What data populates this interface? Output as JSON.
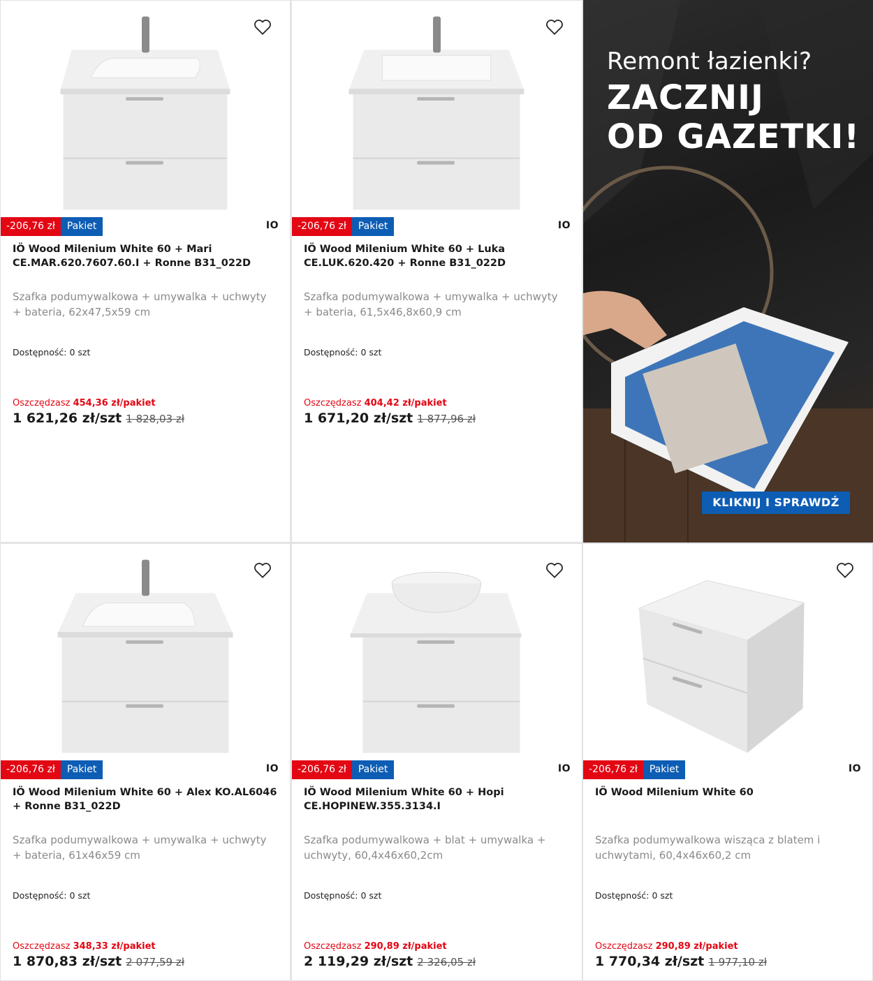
{
  "colors": {
    "discount_red": "#e30613",
    "badge_blue": "#0d5db4",
    "text_dark": "#1a1a1a",
    "text_gray": "#8a8a8a"
  },
  "icons": {
    "favorite": "heart-outline-icon"
  },
  "products": [
    {
      "discount": "-206,76 zł",
      "badge": "Pakiet",
      "brand": "IO",
      "title": "IÖ Wood Milenium White 60 + Mari CE.MAR.620.7607.60.I + Ronne B31_022D",
      "description": "Szafka podumywalkowa + umywalka + uchwyty + bateria, 62x47,5x59 cm",
      "availability": "Dostępność: 0 szt",
      "save_label": "Oszczędzasz",
      "save_amount": "454,36 zł/pakiet",
      "price": "1 621,26 zł/szt",
      "old_price": "1 828,03 zł"
    },
    {
      "discount": "-206,76 zł",
      "badge": "Pakiet",
      "brand": "IO",
      "title": "IÖ Wood Milenium White 60 + Luka CE.LUK.620.420 + Ronne B31_022D",
      "description": "Szafka podumywalkowa + umywalka + uchwyty + bateria, 61,5x46,8x60,9 cm",
      "availability": "Dostępność: 0 szt",
      "save_label": "Oszczędzasz",
      "save_amount": "404,42 zł/pakiet",
      "price": "1 671,20 zł/szt",
      "old_price": "1 877,96 zł"
    },
    {
      "discount": "-206,76 zł",
      "badge": "Pakiet",
      "brand": "IO",
      "title": "IÖ Wood Milenium White 60 + Alex KO.AL6046 + Ronne B31_022D",
      "description": "Szafka podumywalkowa + umywalka + uchwyty + bateria, 61x46x59 cm",
      "availability": "Dostępność: 0 szt",
      "save_label": "Oszczędzasz",
      "save_amount": "348,33 zł/pakiet",
      "price": "1 870,83 zł/szt",
      "old_price": "2 077,59 zł"
    },
    {
      "discount": "-206,76 zł",
      "badge": "Pakiet",
      "brand": "IO",
      "title": "IÖ Wood Milenium White 60 + Hopi CE.HOPINEW.355.3134.I",
      "description": "Szafka podumywalkowa + blat + umywalka + uchwyty, 60,4x46x60,2cm",
      "availability": "Dostępność: 0 szt",
      "save_label": "Oszczędzasz",
      "save_amount": "290,89 zł/pakiet",
      "price": "2 119,29 zł/szt",
      "old_price": "2 326,05 zł"
    },
    {
      "discount": "-206,76 zł",
      "badge": "Pakiet",
      "brand": "IO",
      "title": "IÖ Wood Milenium White 60",
      "description": "Szafka podumywalkowa wisząca z blatem i uchwytami, 60,4x46x60,2 cm",
      "availability": "Dostępność: 0 szt",
      "save_label": "Oszczędzasz",
      "save_amount": "290,89 zł/pakiet",
      "price": "1 770,34 zł/szt",
      "old_price": "1 977,10 zł"
    }
  ],
  "banner": {
    "question": "Remont łazienki?",
    "headline_1": "ZACZNIJ",
    "headline_2": "OD GAZETKI!",
    "cta": "KLIKNIJ I SPRAWDŹ"
  }
}
